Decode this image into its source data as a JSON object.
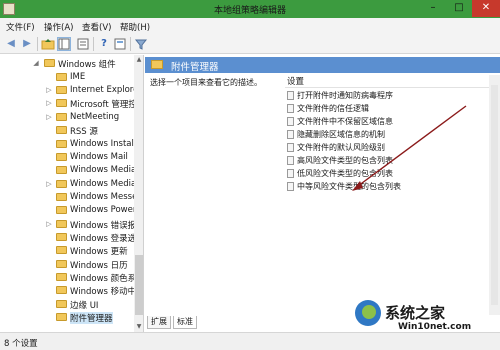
{
  "window": {
    "title": "本地组策略编辑器",
    "controls": {
      "minimize": "–",
      "maximize": "□",
      "close": "✕"
    }
  },
  "menu": [
    {
      "label": "文件(F)"
    },
    {
      "label": "操作(A)"
    },
    {
      "label": "查看(V)"
    },
    {
      "label": "帮助(H)"
    }
  ],
  "toolbar": {
    "icons": [
      "back-icon",
      "forward-icon",
      "folder-up-icon",
      "tree-view-icon",
      "export-list-icon",
      "help-icon",
      "properties-icon",
      "filter-icon"
    ]
  },
  "tree": {
    "items": [
      {
        "label": "Windows 组件",
        "expand": "◢"
      },
      {
        "label": "IME",
        "expand": ""
      },
      {
        "label": "Internet Explore",
        "expand": "▷"
      },
      {
        "label": "Microsoft 管理控",
        "expand": "▷"
      },
      {
        "label": "NetMeeting",
        "expand": "▷"
      },
      {
        "label": "RSS 源",
        "expand": ""
      },
      {
        "label": "Windows Install",
        "expand": ""
      },
      {
        "label": "Windows Mail",
        "expand": ""
      },
      {
        "label": "Windows Media",
        "expand": ""
      },
      {
        "label": "Windows Media",
        "expand": "▷"
      },
      {
        "label": "Windows Messe",
        "expand": ""
      },
      {
        "label": "Windows Power",
        "expand": ""
      },
      {
        "label": "Windows 错误报",
        "expand": "▷"
      },
      {
        "label": "Windows 登录选",
        "expand": ""
      },
      {
        "label": "Windows 更新",
        "expand": ""
      },
      {
        "label": "Windows 日历",
        "expand": ""
      },
      {
        "label": "Windows 颜色系",
        "expand": ""
      },
      {
        "label": "Windows 移动中",
        "expand": ""
      },
      {
        "label": "边缘 UI",
        "expand": ""
      },
      {
        "label": "附件管理器",
        "expand": "",
        "selected": true
      }
    ]
  },
  "pane": {
    "title": "附件管理器",
    "description": "选择一个项目来查看它的描述。",
    "settings_header": "设置",
    "settings": [
      "打开附件时通知防病毒程序",
      "文件附件的信任逻辑",
      "文件附件中不保留区域信息",
      "隐藏删除区域信息的机制",
      "文件附件的默认风险级别",
      "高风险文件类型的包含列表",
      "低风险文件类型的包含列表",
      "中等风险文件类型的包含列表"
    ]
  },
  "tabs": [
    {
      "label": "扩展",
      "active": false
    },
    {
      "label": "标准",
      "active": true
    }
  ],
  "status": {
    "text": "8 个设置"
  },
  "watermark": {
    "text": "系统之家",
    "url": "Win10net.com"
  },
  "colors": {
    "titlebar": "#3c9b3f",
    "pane_header": "#5b8fd0",
    "close_button": "#c7392c",
    "annotation_arrow": "#8b1a1a"
  }
}
